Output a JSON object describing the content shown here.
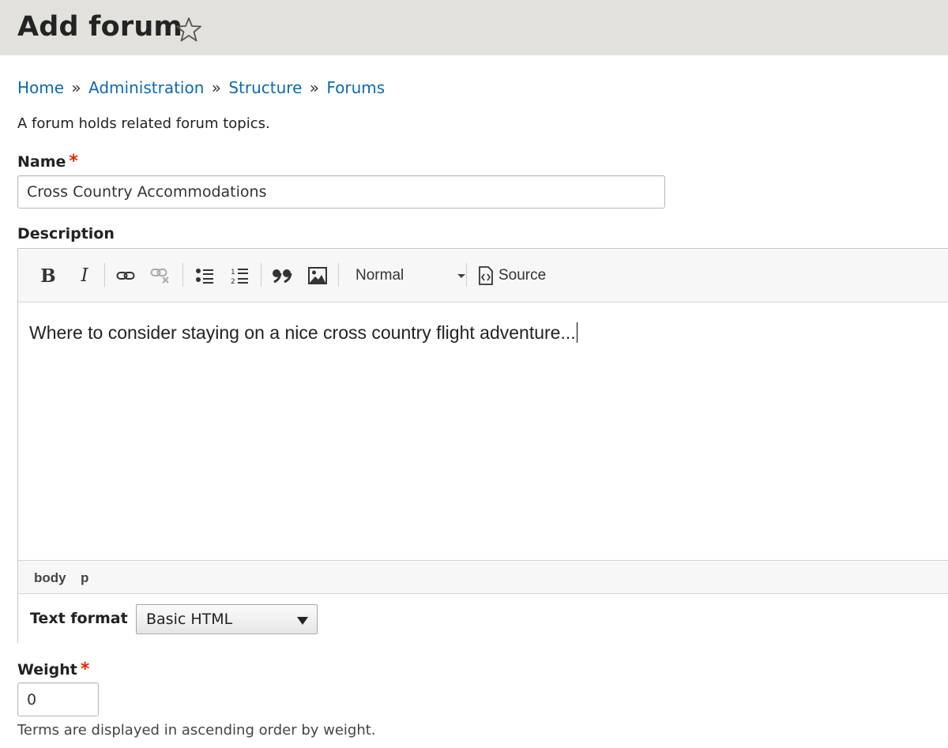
{
  "header": {
    "title": "Add forum",
    "shortcut_icon": "star-outline-icon"
  },
  "breadcrumb": {
    "items": [
      "Home",
      "Administration",
      "Structure",
      "Forums"
    ],
    "separator": "»"
  },
  "intro": "A forum holds related forum topics.",
  "name_field": {
    "label": "Name",
    "required_marker": "*",
    "value": "Cross Country Accommodations"
  },
  "description_field": {
    "label": "Description",
    "toolbar": {
      "bold_label": "B",
      "italic_label": "I",
      "link_icon": "link-icon",
      "unlink_icon": "unlink-icon",
      "bulleted_list_icon": "bulleted-list-icon",
      "numbered_list_icon": "numbered-list-icon",
      "blockquote_icon": "blockquote-icon",
      "image_icon": "image-icon",
      "format_value": "Normal",
      "source_label": "Source"
    },
    "content": "Where to consider staying on a nice cross country flight adventure...",
    "element_path": [
      "body",
      "p"
    ],
    "text_format": {
      "label": "Text format",
      "selected": "Basic HTML"
    }
  },
  "weight_field": {
    "label": "Weight",
    "required_marker": "*",
    "value": "0",
    "help": "Terms are displayed in ascending order by weight."
  },
  "colors": {
    "header_bg": "#e2e1db",
    "link": "#0a6ab5",
    "required": "#e32700"
  }
}
